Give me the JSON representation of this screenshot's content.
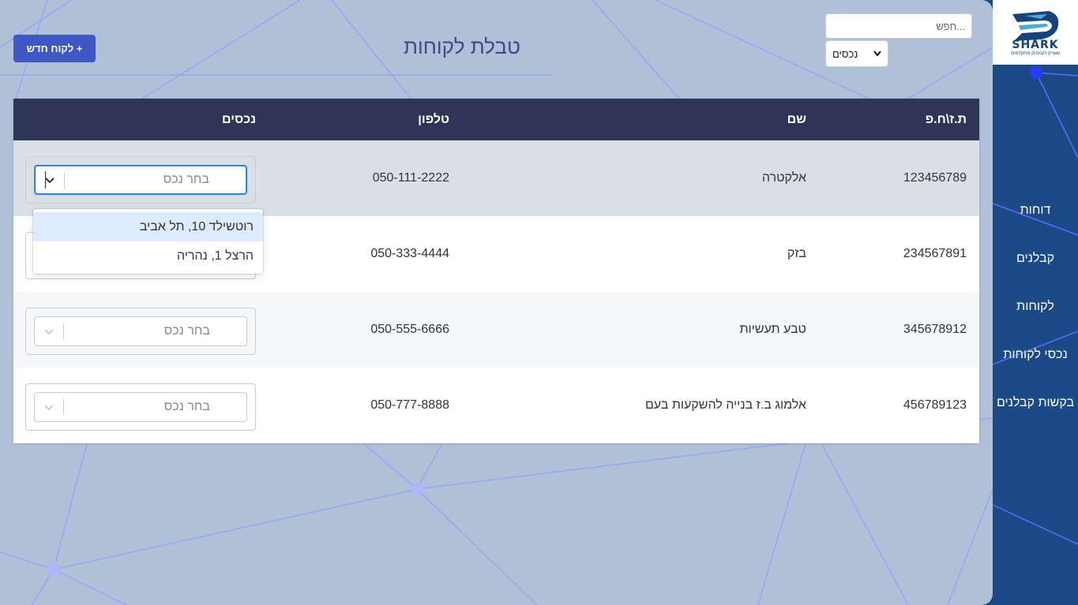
{
  "logo": {
    "name": "SHARK",
    "tagline": "שארק רובוטים מתקדמים"
  },
  "sidebar": {
    "items": [
      {
        "label": "דוחות"
      },
      {
        "label": "קבלנים"
      },
      {
        "label": "לקוחות"
      },
      {
        "label": "נכסי לקוחות"
      },
      {
        "label": "בקשות קבלנים"
      }
    ]
  },
  "header": {
    "title": "טבלת לקוחות",
    "add_button": "+ לקוח חדש",
    "search_placeholder": "...חפש",
    "filter_value": "נכסים"
  },
  "table": {
    "columns": [
      "ת.ז\\ח.פ",
      "שם",
      "טלפון",
      "נכסים"
    ],
    "asset_placeholder": "בחר נכס",
    "rows": [
      {
        "id": "123456789",
        "name": "אלקטרה",
        "phone": "050-111-2222"
      },
      {
        "id": "234567891",
        "name": "בזק",
        "phone": "050-333-4444"
      },
      {
        "id": "345678912",
        "name": "טבע תעשיות",
        "phone": "050-555-6666"
      },
      {
        "id": "456789123",
        "name": "אלמוג ב.ז בנייה להשקעות בעם",
        "phone": "050-777-8888"
      }
    ]
  },
  "dropdown": {
    "options": [
      "רוטשילד 10, תל אביב",
      "הרצל 1, נהריה"
    ]
  },
  "colors": {
    "sidebar": "#1b4a86",
    "main_bg": "#b0c0d7",
    "table_header": "#2e3555",
    "button": "#3f57c7",
    "focus": "#2684ff"
  }
}
